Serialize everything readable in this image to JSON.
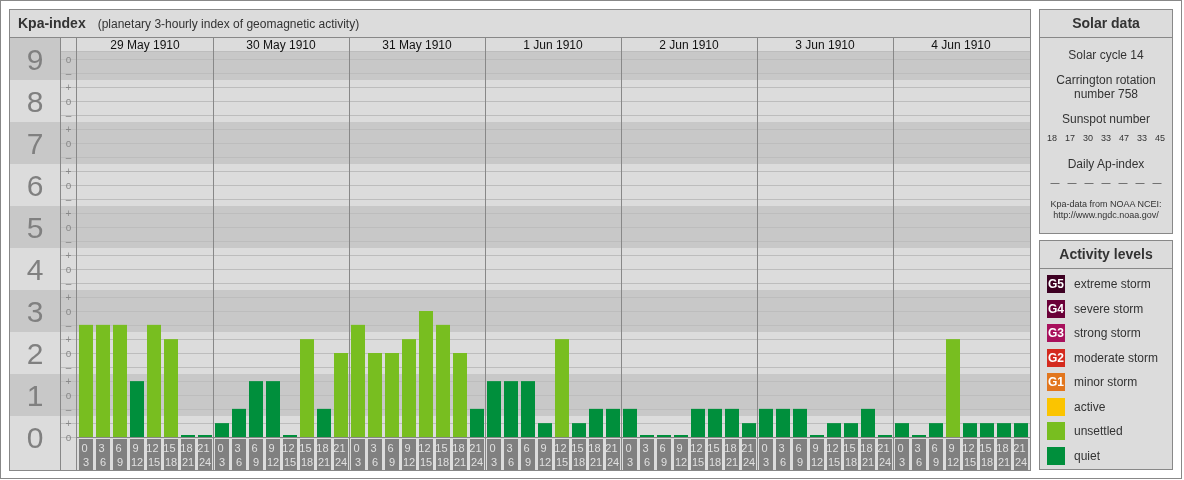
{
  "header": {
    "title": "Kpa-index",
    "subtitle": "(planetary 3-hourly index of geomagnetic activity)"
  },
  "kpa_chart": {
    "days": [
      "29 May 1910",
      "30 May 1910",
      "31 May 1910",
      "1 Jun 1910",
      "2 Jun 1910",
      "3 Jun 1910",
      "4 Jun 1910"
    ],
    "sub_ticks": [
      "o",
      "–",
      "+",
      "o",
      "–",
      "+",
      "o",
      "–",
      "+",
      "o",
      "–",
      "+",
      "o",
      "–",
      "+",
      "o",
      "–",
      "+",
      "o",
      "–",
      "+",
      "o",
      "–",
      "+",
      "o",
      "–",
      "+",
      "o"
    ],
    "chart_data": {
      "type": "bar",
      "ylim": [
        0,
        9.2
      ],
      "grid": true,
      "yticks": [
        {
          "value": 0,
          "label": "0"
        },
        {
          "value": 1,
          "label": "1"
        },
        {
          "value": 2,
          "label": "2"
        },
        {
          "value": 3,
          "label": "3"
        },
        {
          "value": 4,
          "label": "4"
        },
        {
          "value": 5,
          "label": "5"
        },
        {
          "value": 6,
          "label": "6"
        },
        {
          "value": 7,
          "label": "7"
        },
        {
          "value": 8,
          "label": "8"
        },
        {
          "value": 9,
          "label": "9"
        }
      ],
      "categories": [
        "0 3",
        "3 6",
        "6 9",
        "9 12",
        "12 15",
        "15 18",
        "18 21",
        "21 24",
        "0 3",
        "3 6",
        "6 9",
        "9 12",
        "12 15",
        "15 18",
        "18 21",
        "21 24",
        "0 3",
        "3 6",
        "6 9",
        "9 12",
        "12 15",
        "15 18",
        "18 21",
        "21 24",
        "0 3",
        "3 6",
        "6 9",
        "9 12",
        "12 15",
        "15 18",
        "18 21",
        "21 24",
        "0 3",
        "3 6",
        "6 9",
        "9 12",
        "12 15",
        "15 18",
        "18 21",
        "21 24",
        "0 3",
        "3 6",
        "6 9",
        "9 12",
        "12 15",
        "15 18",
        "18 21",
        "21 24",
        "0 3",
        "3 6",
        "6 9",
        "9 12",
        "12 15",
        "15 18",
        "18 21",
        "21 24"
      ],
      "series": [
        {
          "color": "#78be20",
          "values": [
            2.67,
            2.67,
            2.67,
            null,
            2.67,
            2.33,
            null,
            null,
            null,
            null,
            null,
            null,
            null,
            2.33,
            null,
            2,
            2.67,
            2,
            2,
            2.33,
            3,
            2.67,
            2,
            null,
            null,
            null,
            null,
            null,
            2.33,
            null,
            null,
            null,
            null,
            null,
            null,
            null,
            null,
            null,
            null,
            null,
            null,
            null,
            null,
            null,
            null,
            null,
            null,
            null,
            null,
            null,
            null,
            2.33,
            null,
            null,
            null,
            null
          ]
        },
        {
          "color": "#008f3c",
          "values": [
            null,
            null,
            null,
            1.33,
            null,
            null,
            0,
            0,
            0.33,
            0.67,
            1.33,
            1.33,
            0,
            null,
            0.67,
            null,
            null,
            null,
            null,
            null,
            null,
            null,
            null,
            0.67,
            1.33,
            1.33,
            1.33,
            0.33,
            null,
            0.33,
            0.67,
            0.67,
            0.67,
            0,
            0,
            0,
            0.67,
            0.67,
            0.67,
            0.33,
            0.67,
            0.67,
            0.67,
            0,
            0.33,
            0.33,
            0.67,
            0,
            0.33,
            0,
            0.33,
            null,
            0.33,
            0.33,
            0.33,
            0.33
          ]
        }
      ]
    }
  },
  "solar_data": {
    "title": "Solar data",
    "solar_cycle": "Solar cycle 14",
    "carrington": "Carrington rotation number 758",
    "sunspot_label": "Sunspot number",
    "sunspot_numbers": [
      "18",
      "17",
      "30",
      "33",
      "47",
      "33",
      "45"
    ],
    "ap_label": "Daily Ap-index",
    "ap_values": [
      "—",
      "—",
      "—",
      "—",
      "—",
      "—",
      "—"
    ],
    "credit": "Kpa-data from NOAA NCEI:",
    "credit_url": "http://www.ngdc.noaa.gov/"
  },
  "activity_levels": {
    "title": "Activity levels",
    "items": [
      {
        "badge": "G5",
        "label": "extreme storm",
        "color": "#3d0022"
      },
      {
        "badge": "G4",
        "label": "severe storm",
        "color": "#6a0038"
      },
      {
        "badge": "G3",
        "label": "strong storm",
        "color": "#a8105c"
      },
      {
        "badge": "G2",
        "label": "moderate storm",
        "color": "#d42a1e"
      },
      {
        "badge": "G1",
        "label": "minor storm",
        "color": "#e2761e"
      },
      {
        "label": "active",
        "color": "#fbc400"
      },
      {
        "label": "unsettled",
        "color": "#78be20"
      },
      {
        "label": "quiet",
        "color": "#008f3c"
      }
    ]
  }
}
